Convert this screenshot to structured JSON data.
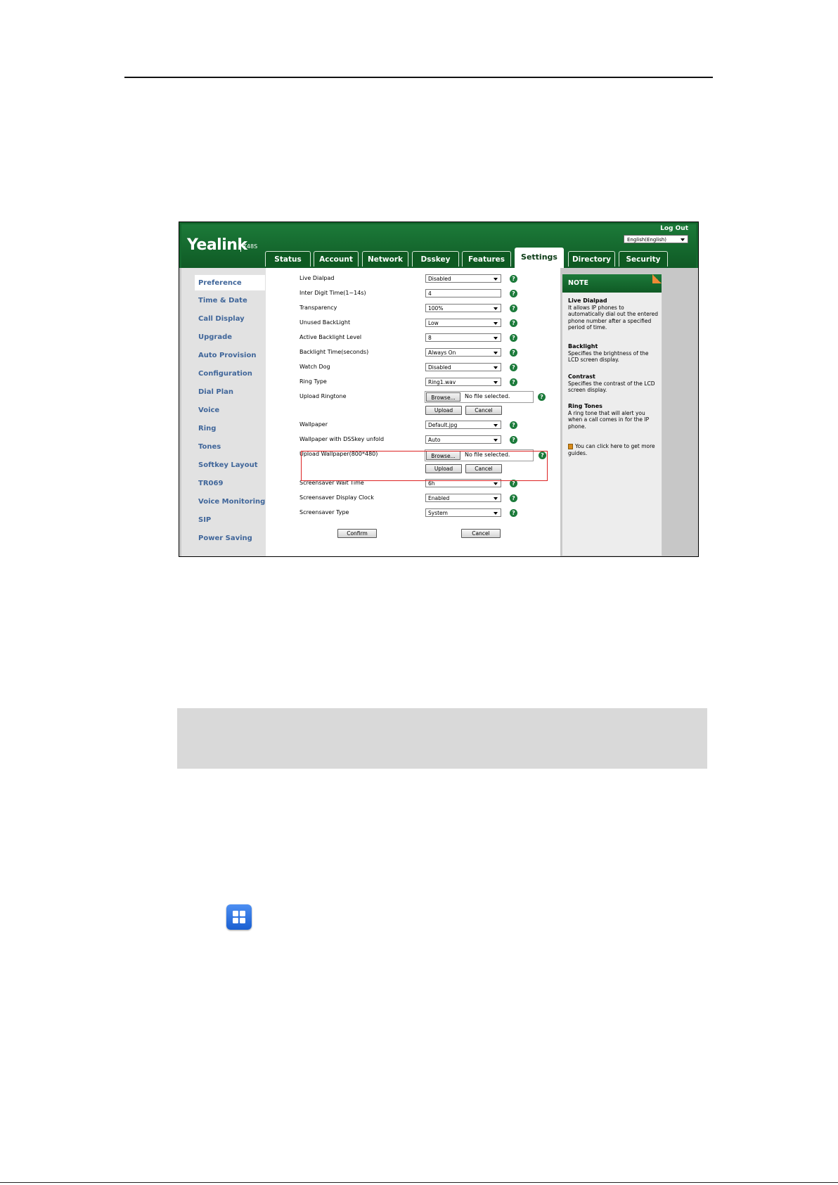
{
  "screenshot": {
    "brand": "Yealink",
    "model": "T48S",
    "logout_label": "Log Out",
    "language_value": "English(English)",
    "tabs": [
      {
        "label": "Status"
      },
      {
        "label": "Account"
      },
      {
        "label": "Network"
      },
      {
        "label": "Dsskey"
      },
      {
        "label": "Features"
      },
      {
        "label": "Settings",
        "active": true
      },
      {
        "label": "Directory"
      },
      {
        "label": "Security"
      }
    ],
    "sidebar": [
      {
        "label": "Preference",
        "active": true
      },
      {
        "label": "Time & Date"
      },
      {
        "label": "Call Display"
      },
      {
        "label": "Upgrade"
      },
      {
        "label": "Auto Provision"
      },
      {
        "label": "Configuration"
      },
      {
        "label": "Dial Plan"
      },
      {
        "label": "Voice"
      },
      {
        "label": "Ring"
      },
      {
        "label": "Tones"
      },
      {
        "label": "Softkey Layout"
      },
      {
        "label": "TR069"
      },
      {
        "label": "Voice Monitoring"
      },
      {
        "label": "SIP"
      },
      {
        "label": "Power Saving"
      }
    ],
    "fields": {
      "live_dialpad": {
        "label": "Live Dialpad",
        "value": "Disabled"
      },
      "inter_digit": {
        "label": "Inter Digit Time(1~14s)",
        "value": "4"
      },
      "transparency": {
        "label": "Transparency",
        "value": "100%"
      },
      "unused_backlight": {
        "label": "Unused BackLight",
        "value": "Low"
      },
      "active_backlight": {
        "label": "Active Backlight Level",
        "value": "8"
      },
      "backlight_time": {
        "label": "Backlight Time(seconds)",
        "value": "Always On"
      },
      "watch_dog": {
        "label": "Watch Dog",
        "value": "Disabled"
      },
      "ring_type": {
        "label": "Ring Type",
        "value": "Ring1.wav"
      },
      "upload_ringtone": {
        "label": "Upload Ringtone",
        "browse": "Browse...",
        "file": "No file selected.",
        "upload": "Upload",
        "cancel": "Cancel"
      },
      "wallpaper": {
        "label": "Wallpaper",
        "value": "Default.jpg"
      },
      "wallpaper_dsskey": {
        "label": "Wallpaper with DSSkey unfold",
        "value": "Auto"
      },
      "upload_wallpaper": {
        "label": "Upload Wallpaper(800*480)",
        "browse": "Browse...",
        "file": "No file selected.",
        "upload": "Upload",
        "cancel": "Cancel"
      },
      "screensaver_wait": {
        "label": "Screensaver Wait Time",
        "value": "6h"
      },
      "screensaver_clock": {
        "label": "Screensaver Display Clock",
        "value": "Enabled"
      },
      "screensaver_type": {
        "label": "Screensaver Type",
        "value": "System"
      }
    },
    "confirm_label": "Confirm",
    "cancel_label": "Cancel",
    "help_glyph": "?",
    "note": {
      "title": "NOTE",
      "blocks": [
        {
          "title": "Live Dialpad",
          "text": "It allows IP phones to automatically dial out the entered phone number after a specified period of time."
        },
        {
          "title": "Backlight",
          "text": "Specifies the brightness of the LCD screen display."
        },
        {
          "title": "Contrast",
          "text": "Specifies the contrast of the LCD screen display."
        },
        {
          "title": "Ring Tones",
          "text": "A ring tone that will alert you when a call comes in for the IP phone."
        }
      ],
      "link_text": "You can click here to get more guides."
    }
  },
  "colors": {
    "header_green": "#14682e",
    "sidebar_blue": "#40669a",
    "highlight_red": "#dd2222",
    "note_orange": "#e8782a",
    "icon_blue": "#2a6fe0"
  },
  "icons": {
    "app_icon": "grid-app-icon",
    "help": "help-icon",
    "book": "book-icon"
  }
}
